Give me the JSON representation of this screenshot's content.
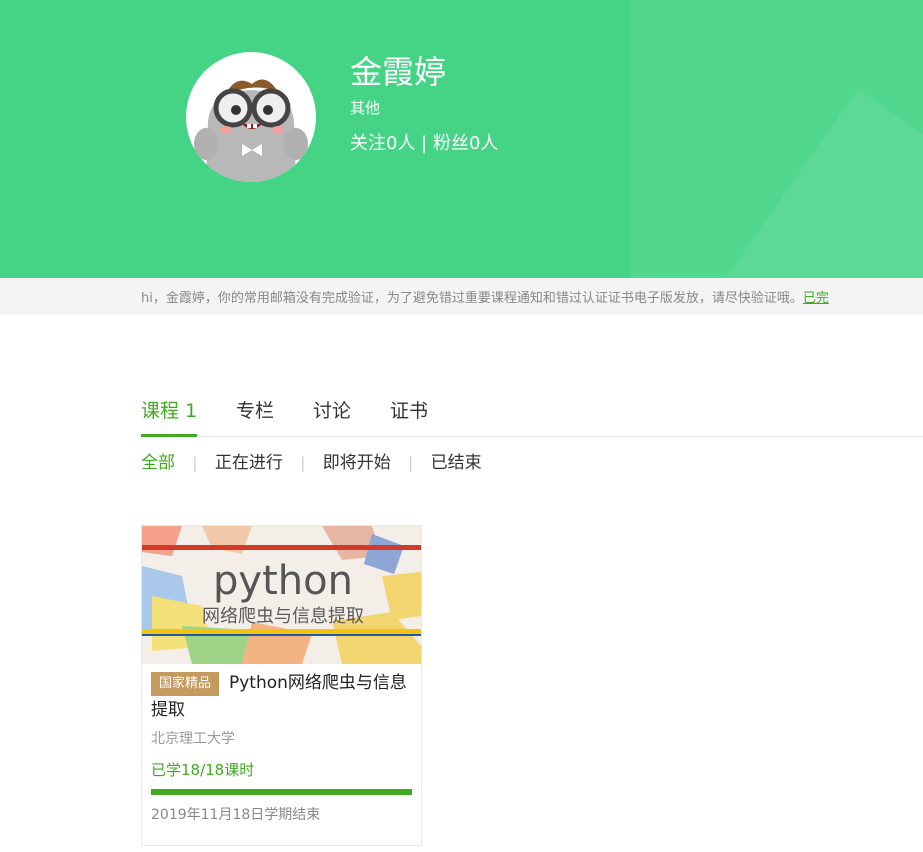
{
  "profile": {
    "name": "金霞婷",
    "role": "其他",
    "follow_stats": "关注0人 | 粉丝0人"
  },
  "notice": {
    "message": "hi，金霞婷，你的常用邮箱没有完成验证，为了避免错过重要课程通知和错过认证证书电子版发放，请尽快验证哦。",
    "link_text": "已完"
  },
  "tabs": [
    {
      "label": "课程 1"
    },
    {
      "label": "专栏"
    },
    {
      "label": "讨论"
    },
    {
      "label": "证书"
    }
  ],
  "filters": [
    {
      "label": "全部"
    },
    {
      "label": "正在进行"
    },
    {
      "label": "即将开始"
    },
    {
      "label": "已结束"
    }
  ],
  "course": {
    "cover_word": "python",
    "cover_subtitle": "网络爬虫与信息提取",
    "badge": "国家精品",
    "title": "Python网络爬虫与信息提取",
    "school": "北京理工大学",
    "progress_text": "已学18/18课时",
    "progress_fraction": 1.0,
    "term_end": "2019年11月18日学期结束"
  },
  "colors": {
    "banner_green": "#45d486",
    "accent_green": "#3faa1f",
    "badge_gold": "#c49a5e"
  }
}
